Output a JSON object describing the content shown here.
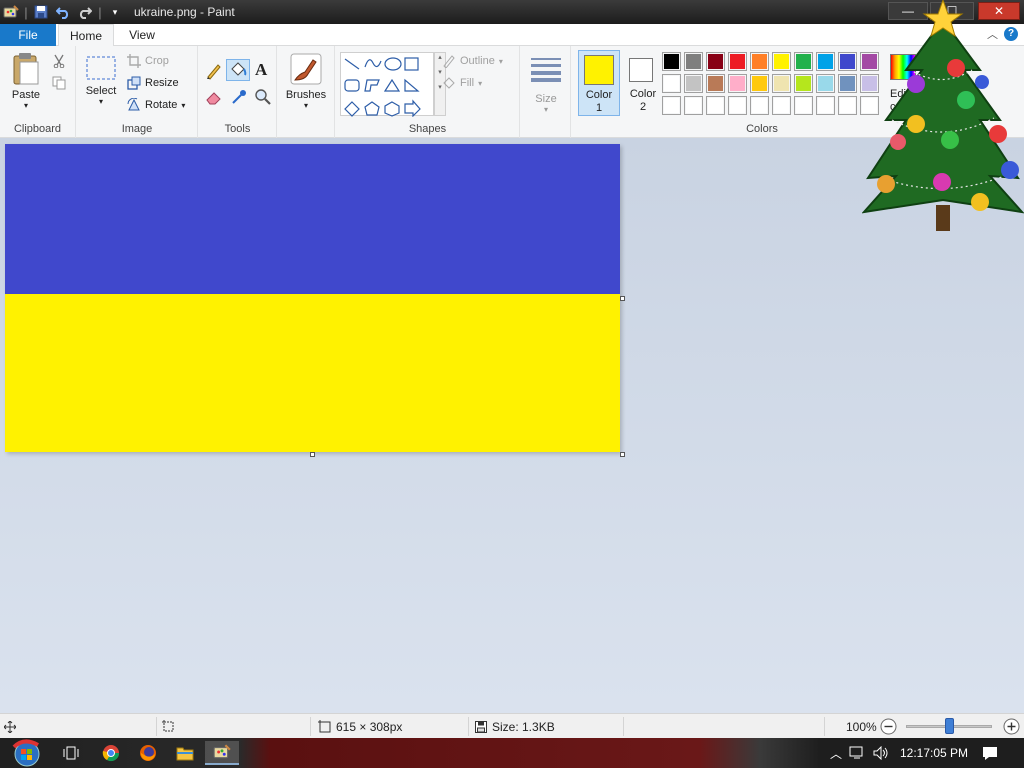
{
  "window": {
    "title": "ukraine.png - Paint",
    "controls": {
      "minimize": "—",
      "maximize": "☐",
      "close": "✕"
    }
  },
  "quick_access": {
    "icons": [
      "paint-app-icon",
      "save-icon",
      "undo-icon",
      "redo-icon",
      "customize-dropdown-icon"
    ]
  },
  "tabs": {
    "file": "File",
    "home": "Home",
    "view": "View"
  },
  "ribbon": {
    "clipboard": {
      "label": "Clipboard",
      "paste": "Paste"
    },
    "image": {
      "label": "Image",
      "select": "Select",
      "crop": "Crop",
      "resize": "Resize",
      "rotate": "Rotate"
    },
    "tools": {
      "label": "Tools"
    },
    "brushes": {
      "label": "Brushes"
    },
    "shapes": {
      "label": "Shapes",
      "outline": "Outline",
      "fill": "Fill"
    },
    "size": {
      "label": "Size"
    },
    "colors": {
      "label": "Colors",
      "color1": "Color\n1",
      "color2": "Color\n2",
      "color1_value": "#fff200",
      "color2_value": "#ffffff",
      "edit_colors": "Edit\nco",
      "palette_row1": [
        "#000000",
        "#7f7f7f",
        "#880015",
        "#ed1c24",
        "#ff7f27",
        "#fff200",
        "#22b14c",
        "#00a2e8",
        "#3f48cc",
        "#a349a4"
      ],
      "palette_row2": [
        "#ffffff",
        "#c3c3c3",
        "#b97a57",
        "#ffaec9",
        "#ffc90e",
        "#efe4b0",
        "#b5e61d",
        "#99d9ea",
        "#7092be",
        "#c8bfe7"
      ],
      "palette_row3": [
        "#ffffff",
        "#ffffff",
        "#ffffff",
        "#ffffff",
        "#ffffff",
        "#ffffff",
        "#ffffff",
        "#ffffff",
        "#ffffff",
        "#ffffff"
      ]
    }
  },
  "canvas": {
    "colors": {
      "top_band": "#4048cc",
      "bottom_band": "#fff200"
    }
  },
  "statusbar": {
    "dimensions": "615 × 308px",
    "size": "Size: 1.3KB",
    "zoom": "100%",
    "zoom_level": 1.0
  },
  "taskbar": {
    "clock": "12:17:05 PM"
  }
}
